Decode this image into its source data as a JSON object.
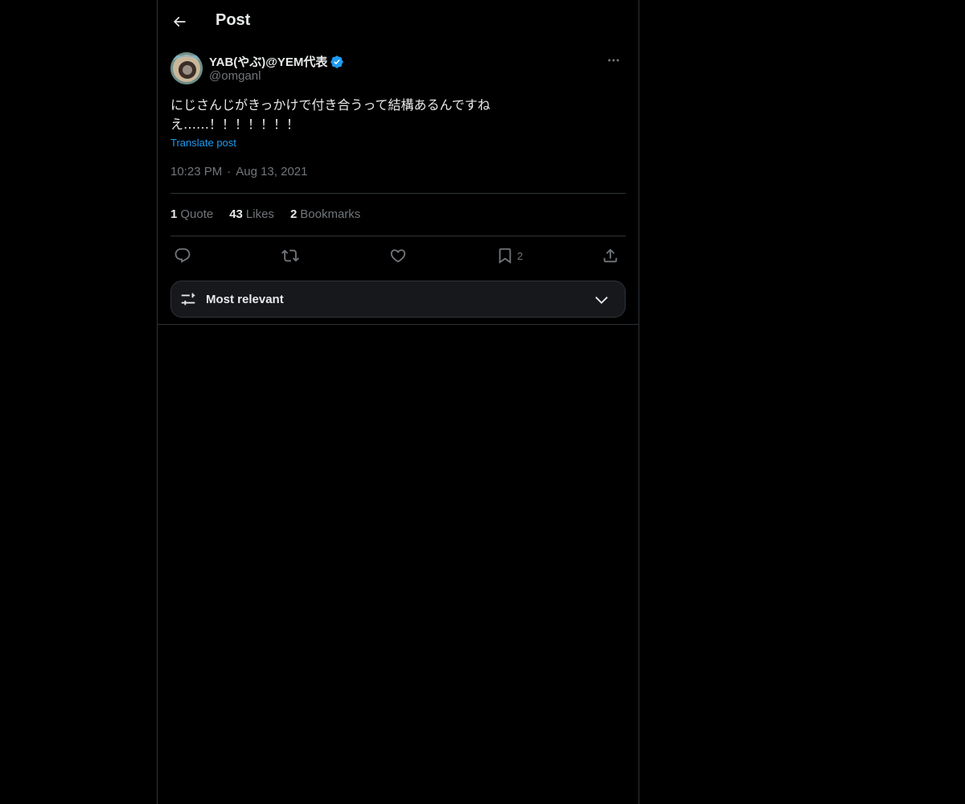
{
  "header": {
    "title": "Post"
  },
  "author": {
    "display_name": "YAB(やぶ)@YEM代表",
    "handle": "@omganl",
    "verified": true
  },
  "tweet": {
    "text_line1": "にじさんじがきっかけで付き合うって結構あるんですね",
    "text_line2": "え……！！！！！！！",
    "translate_label": "Translate post",
    "time": "10:23 PM",
    "separator": "·",
    "date": "Aug 13, 2021"
  },
  "stats": {
    "quotes": {
      "count": "1",
      "label": "Quote"
    },
    "likes": {
      "count": "43",
      "label": "Likes"
    },
    "bookmarks": {
      "count": "2",
      "label": "Bookmarks"
    }
  },
  "actions": {
    "reply_icon": "reply-icon",
    "retweet_icon": "retweet-icon",
    "like_icon": "heart-icon",
    "bookmark_icon": "bookmark-icon",
    "bookmark_count": "2",
    "share_icon": "share-icon"
  },
  "sort": {
    "label": "Most relevant"
  },
  "colors": {
    "background": "#000000",
    "text": "#e7e9ea",
    "muted": "#71767b",
    "accent": "#1d9bf0",
    "border": "#2f3336"
  }
}
